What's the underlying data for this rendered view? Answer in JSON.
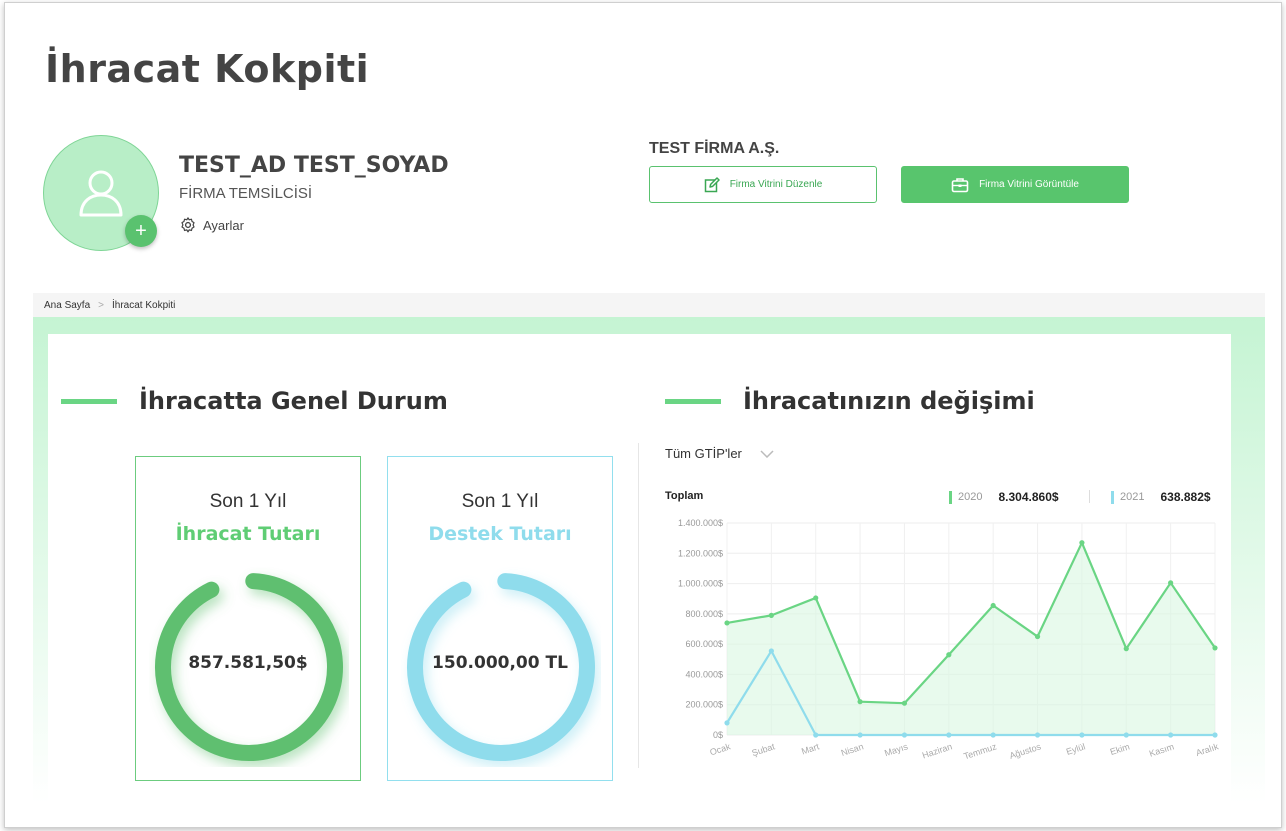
{
  "header": {
    "title": "İhracat Kokpiti"
  },
  "user": {
    "name": "TEST_AD TEST_SOYAD",
    "role": "FİRMA TEMSİLCİSİ",
    "settings_label": "Ayarlar"
  },
  "company": {
    "name": "TEST FİRMA A.Ş.",
    "edit_button": "Firma Vitrini Düzenle",
    "view_button": "Firma Vitrini Görüntüle"
  },
  "breadcrumb": {
    "home": "Ana Sayfa",
    "current": "İhracat Kokpiti"
  },
  "general": {
    "title": "İhracatta Genel Durum",
    "cards": [
      {
        "period": "Son 1 Yıl",
        "title": "İhracat Tutarı",
        "value": "857.581,50$",
        "fraction": 0.92,
        "color": "#5fbf6f"
      },
      {
        "period": "Son 1 Yıl",
        "title": "Destek Tutarı",
        "value": "150.000,00 TL",
        "fraction": 0.92,
        "color": "#8fdcec"
      }
    ]
  },
  "change": {
    "title": "İhracatınızın değişimi",
    "filter": "Tüm GTİP'ler",
    "total_label": "Toplam",
    "legend": [
      {
        "year": "2020",
        "amount": "8.304.860$",
        "color": "#6ad584"
      },
      {
        "year": "2021",
        "amount": "638.882$",
        "color": "#8fdcec"
      }
    ]
  },
  "chart_data": {
    "type": "line",
    "categories": [
      "Ocak",
      "Şubat",
      "Mart",
      "Nisan",
      "Mayıs",
      "Haziran",
      "Temmuz",
      "Ağustos",
      "Eylül",
      "Ekim",
      "Kasım",
      "Aralık"
    ],
    "ylim": [
      0,
      1400000
    ],
    "yticks": [
      "0$",
      "200.000$",
      "400.000$",
      "600.000$",
      "800.000$",
      "1.000.000$",
      "1.200.000$",
      "1.400.000$"
    ],
    "series": [
      {
        "name": "2020",
        "values": [
          740000,
          790000,
          905000,
          220000,
          210000,
          530000,
          855000,
          650000,
          1270000,
          570000,
          1005000,
          575000
        ],
        "color": "#6ad584"
      },
      {
        "name": "2021",
        "values": [
          80000,
          555000,
          0,
          0,
          0,
          0,
          0,
          0,
          0,
          0,
          0,
          0
        ],
        "color": "#8fdcec"
      }
    ]
  }
}
